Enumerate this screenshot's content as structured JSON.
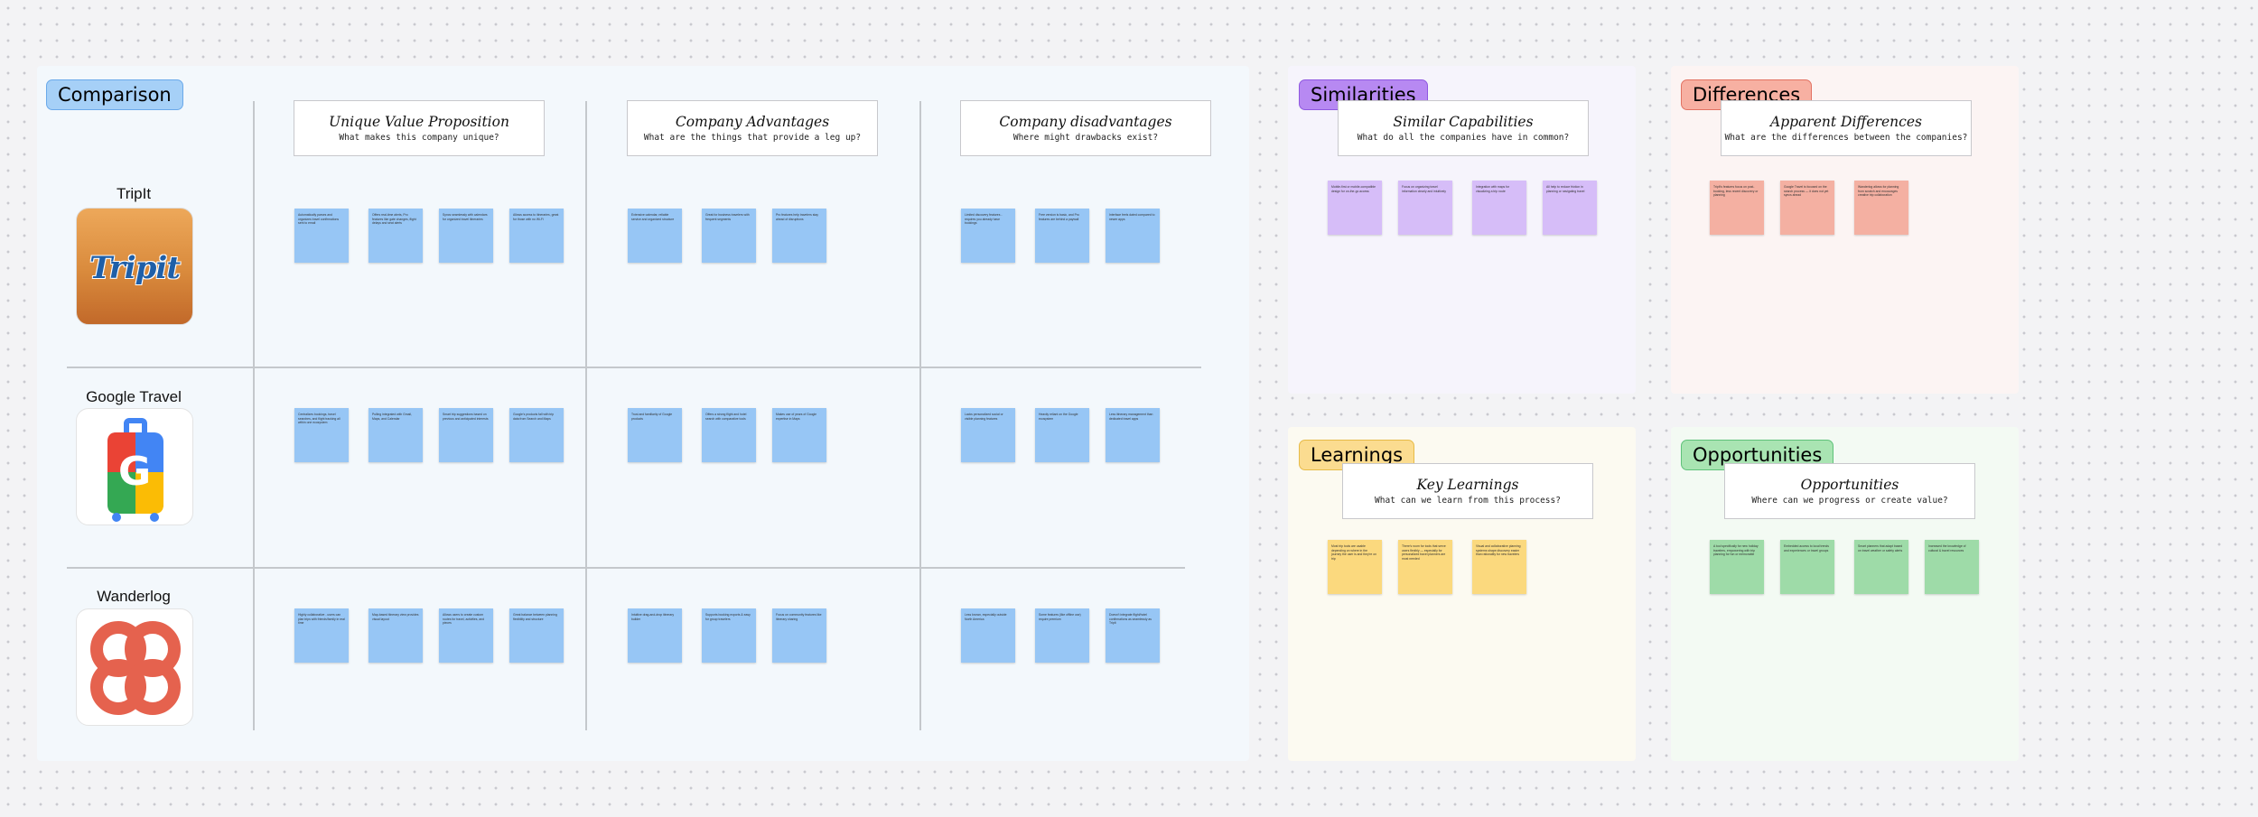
{
  "comparison": {
    "tag": "Comparison",
    "columns": [
      {
        "title": "Unique Value Proposition",
        "subtitle": "What makes this company unique?"
      },
      {
        "title": "Company Advantages",
        "subtitle": "What are the things that provide a leg up?"
      },
      {
        "title": "Company disadvantages",
        "subtitle": "Where might drawbacks exist?"
      }
    ],
    "companies": [
      {
        "name": "TripIt",
        "logo_text": "Tripit"
      },
      {
        "name": "Google Travel",
        "logo_text": "G"
      },
      {
        "name": "Wanderlog",
        "logo_text": ""
      }
    ],
    "cells": [
      [
        [
          "Automatically parses and organizes travel confirmations sent to email",
          "Offers real-time alerts, Pro features like gate changes, flight delays and seat alerts",
          "Syncs seamlessly with calendars for organized travel itineraries",
          "Allows access to itineraries, great for those with no Wi-Fi"
        ],
        [
          "Extensive calendar, reliable service and organized structure",
          "Great for business travelers with frequent segments",
          "Pro features help travelers stay ahead of disruptions"
        ],
        [
          "Limited discovery features - requires you already have bookings",
          "Free version is basic, and Pro features are behind a paywall",
          "Interface feels dated compared to newer apps"
        ]
      ],
      [
        [
          "Centralizes bookings, travel searches, and flight tracking all within one ecosystem",
          "Pulling integrated with Gmail, Maps, and Calendar",
          "Smart trip suggestions based on previous and anticipated interests",
          "Google's products fall with trip data from Search and Maps"
        ],
        [
          "Trust and familiarity of Google products",
          "Offers a strong flight and hotel search with comparative tools",
          "Makes use of years of Google expertise in Maps"
        ],
        [
          "Lacks personalized social or visible planning features",
          "Heavily reliant on the Google ecosystem",
          "Less itinerary management than dedicated travel apps"
        ]
      ],
      [
        [
          "Highly collaborative - users can plan trips with friends/family in real time",
          "Map-based itinerary view provides visual layout",
          "Allows users to create custom routes for travel, activities, and pieces",
          "Great balance between planning flexibility and structure"
        ],
        [
          "Intuitive drag-and-drop itinerary builder",
          "Supports booking exports & easy for group travelers",
          "Focus on community features like itinerary sharing"
        ],
        [
          "Less known, especially outside North America",
          "Some features (like offline use) require premium",
          "Doesn't integrate flight/hotel confirmations as seamlessly as TripIt"
        ]
      ]
    ]
  },
  "similarities": {
    "tag": "Similarities",
    "title": "Similar Capabilities",
    "subtitle": "What do all the companies have in common?",
    "notes": [
      "Mobile-first or mobile-compatible design for on-the-go access",
      "Focus on organizing travel information clearly and intuitively",
      "Integration with maps for visualizing a trip route",
      "All help to reduce friction in planning or navigating travel"
    ]
  },
  "differences": {
    "tag": "Differences",
    "title": "Apparent Differences",
    "subtitle": "What are the differences between the companies?",
    "notes": [
      "TripIt's features focus on post-booking, less recent discovery or planning",
      "Google Travel is focused on the search process — it does not yet syncs ahead",
      "Wanderlog allows for planning from scratch and encourages creative trip collaboration"
    ]
  },
  "learnings": {
    "tag": "Learnings",
    "title": "Key Learnings",
    "subtitle": "What can we learn from this process?",
    "notes": [
      "Most trip tools are usable depending on where in the journey the user is and they're on trip",
      "There's room for tools that serve users flexibly — especially for personalized travel planners are most needed",
      "Visual and collaborative planning systems shape discovery easier than rationality for new travelers"
    ]
  },
  "opportunities": {
    "tag": "Opportunities",
    "title": "Opportunities",
    "subtitle": "Where can we progress or create value?",
    "notes": [
      "A tool specifically for new holiday travelers, empowering with trip planning for fun or memorable",
      "Embedded access to local trends and experiences or travel groups",
      "Smart planners that adapt based on travel weather or safety alerts",
      "Increased the knowledge of cultural & travel resources"
    ]
  },
  "colors": {
    "comparison_bg": "#f3f8fc",
    "blue_sticky": "#97c6f5",
    "purple_sticky": "#d6bdf8",
    "red_sticky": "#f4b0a2",
    "yellow_sticky": "#fbd97e",
    "green_sticky": "#9edba8"
  },
  "icons": {
    "tripit": "tripit-logo-icon",
    "google_travel": "google-travel-suitcase-icon",
    "wanderlog": "wanderlog-logo-icon"
  }
}
